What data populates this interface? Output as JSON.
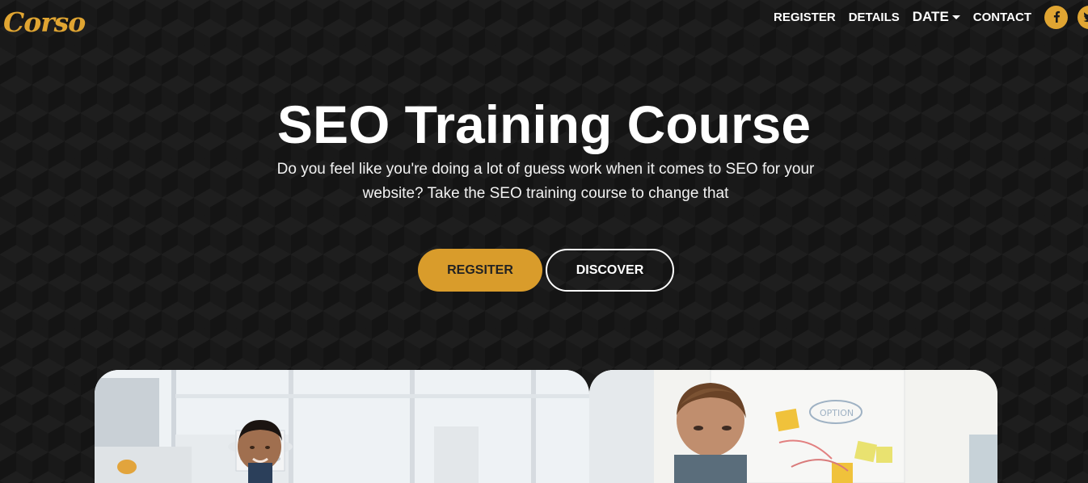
{
  "brand": {
    "logo_text": "Corso",
    "accent_color": "#e0a532"
  },
  "nav": {
    "items": [
      {
        "label": "REGISTER"
      },
      {
        "label": "DETAILS"
      },
      {
        "label": "DATE",
        "has_dropdown": true
      },
      {
        "label": "CONTACT"
      }
    ],
    "social": [
      {
        "icon": "facebook-icon",
        "glyph": "f"
      },
      {
        "icon": "twitter-icon",
        "glyph": ""
      }
    ]
  },
  "hero": {
    "title": "SEO Training Course",
    "subtitle": "Do you feel like you're doing a lot of guess work when it comes to SEO for your website? Take the SEO training course to change that",
    "primary_button": "REGSITER",
    "secondary_button": "DISCOVER"
  },
  "cards": [
    {
      "image": "photo-man-smiling-in-bright-office"
    },
    {
      "image": "photo-man-at-whiteboard-with-sticky-notes"
    }
  ]
}
